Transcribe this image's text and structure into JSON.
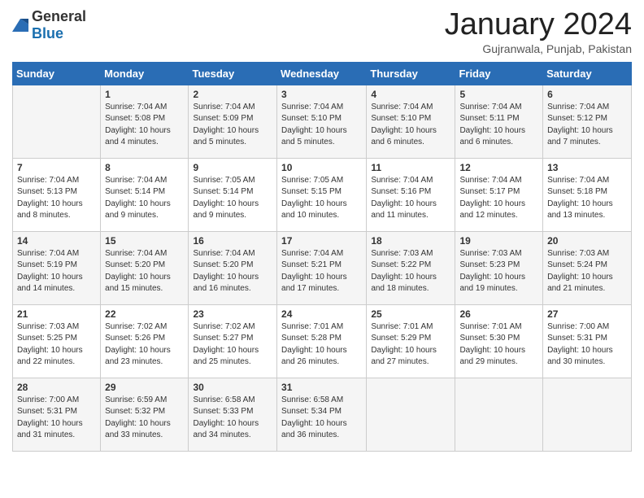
{
  "logo": {
    "general": "General",
    "blue": "Blue"
  },
  "title": {
    "month": "January 2024",
    "location": "Gujranwala, Punjab, Pakistan"
  },
  "headers": [
    "Sunday",
    "Monday",
    "Tuesday",
    "Wednesday",
    "Thursday",
    "Friday",
    "Saturday"
  ],
  "weeks": [
    [
      {
        "day": "",
        "info": ""
      },
      {
        "day": "1",
        "info": "Sunrise: 7:04 AM\nSunset: 5:08 PM\nDaylight: 10 hours\nand 4 minutes."
      },
      {
        "day": "2",
        "info": "Sunrise: 7:04 AM\nSunset: 5:09 PM\nDaylight: 10 hours\nand 5 minutes."
      },
      {
        "day": "3",
        "info": "Sunrise: 7:04 AM\nSunset: 5:10 PM\nDaylight: 10 hours\nand 5 minutes."
      },
      {
        "day": "4",
        "info": "Sunrise: 7:04 AM\nSunset: 5:10 PM\nDaylight: 10 hours\nand 6 minutes."
      },
      {
        "day": "5",
        "info": "Sunrise: 7:04 AM\nSunset: 5:11 PM\nDaylight: 10 hours\nand 6 minutes."
      },
      {
        "day": "6",
        "info": "Sunrise: 7:04 AM\nSunset: 5:12 PM\nDaylight: 10 hours\nand 7 minutes."
      }
    ],
    [
      {
        "day": "7",
        "info": "Sunrise: 7:04 AM\nSunset: 5:13 PM\nDaylight: 10 hours\nand 8 minutes."
      },
      {
        "day": "8",
        "info": "Sunrise: 7:04 AM\nSunset: 5:14 PM\nDaylight: 10 hours\nand 9 minutes."
      },
      {
        "day": "9",
        "info": "Sunrise: 7:05 AM\nSunset: 5:14 PM\nDaylight: 10 hours\nand 9 minutes."
      },
      {
        "day": "10",
        "info": "Sunrise: 7:05 AM\nSunset: 5:15 PM\nDaylight: 10 hours\nand 10 minutes."
      },
      {
        "day": "11",
        "info": "Sunrise: 7:04 AM\nSunset: 5:16 PM\nDaylight: 10 hours\nand 11 minutes."
      },
      {
        "day": "12",
        "info": "Sunrise: 7:04 AM\nSunset: 5:17 PM\nDaylight: 10 hours\nand 12 minutes."
      },
      {
        "day": "13",
        "info": "Sunrise: 7:04 AM\nSunset: 5:18 PM\nDaylight: 10 hours\nand 13 minutes."
      }
    ],
    [
      {
        "day": "14",
        "info": "Sunrise: 7:04 AM\nSunset: 5:19 PM\nDaylight: 10 hours\nand 14 minutes."
      },
      {
        "day": "15",
        "info": "Sunrise: 7:04 AM\nSunset: 5:20 PM\nDaylight: 10 hours\nand 15 minutes."
      },
      {
        "day": "16",
        "info": "Sunrise: 7:04 AM\nSunset: 5:20 PM\nDaylight: 10 hours\nand 16 minutes."
      },
      {
        "day": "17",
        "info": "Sunrise: 7:04 AM\nSunset: 5:21 PM\nDaylight: 10 hours\nand 17 minutes."
      },
      {
        "day": "18",
        "info": "Sunrise: 7:03 AM\nSunset: 5:22 PM\nDaylight: 10 hours\nand 18 minutes."
      },
      {
        "day": "19",
        "info": "Sunrise: 7:03 AM\nSunset: 5:23 PM\nDaylight: 10 hours\nand 19 minutes."
      },
      {
        "day": "20",
        "info": "Sunrise: 7:03 AM\nSunset: 5:24 PM\nDaylight: 10 hours\nand 21 minutes."
      }
    ],
    [
      {
        "day": "21",
        "info": "Sunrise: 7:03 AM\nSunset: 5:25 PM\nDaylight: 10 hours\nand 22 minutes."
      },
      {
        "day": "22",
        "info": "Sunrise: 7:02 AM\nSunset: 5:26 PM\nDaylight: 10 hours\nand 23 minutes."
      },
      {
        "day": "23",
        "info": "Sunrise: 7:02 AM\nSunset: 5:27 PM\nDaylight: 10 hours\nand 25 minutes."
      },
      {
        "day": "24",
        "info": "Sunrise: 7:01 AM\nSunset: 5:28 PM\nDaylight: 10 hours\nand 26 minutes."
      },
      {
        "day": "25",
        "info": "Sunrise: 7:01 AM\nSunset: 5:29 PM\nDaylight: 10 hours\nand 27 minutes."
      },
      {
        "day": "26",
        "info": "Sunrise: 7:01 AM\nSunset: 5:30 PM\nDaylight: 10 hours\nand 29 minutes."
      },
      {
        "day": "27",
        "info": "Sunrise: 7:00 AM\nSunset: 5:31 PM\nDaylight: 10 hours\nand 30 minutes."
      }
    ],
    [
      {
        "day": "28",
        "info": "Sunrise: 7:00 AM\nSunset: 5:31 PM\nDaylight: 10 hours\nand 31 minutes."
      },
      {
        "day": "29",
        "info": "Sunrise: 6:59 AM\nSunset: 5:32 PM\nDaylight: 10 hours\nand 33 minutes."
      },
      {
        "day": "30",
        "info": "Sunrise: 6:58 AM\nSunset: 5:33 PM\nDaylight: 10 hours\nand 34 minutes."
      },
      {
        "day": "31",
        "info": "Sunrise: 6:58 AM\nSunset: 5:34 PM\nDaylight: 10 hours\nand 36 minutes."
      },
      {
        "day": "",
        "info": ""
      },
      {
        "day": "",
        "info": ""
      },
      {
        "day": "",
        "info": ""
      }
    ]
  ]
}
